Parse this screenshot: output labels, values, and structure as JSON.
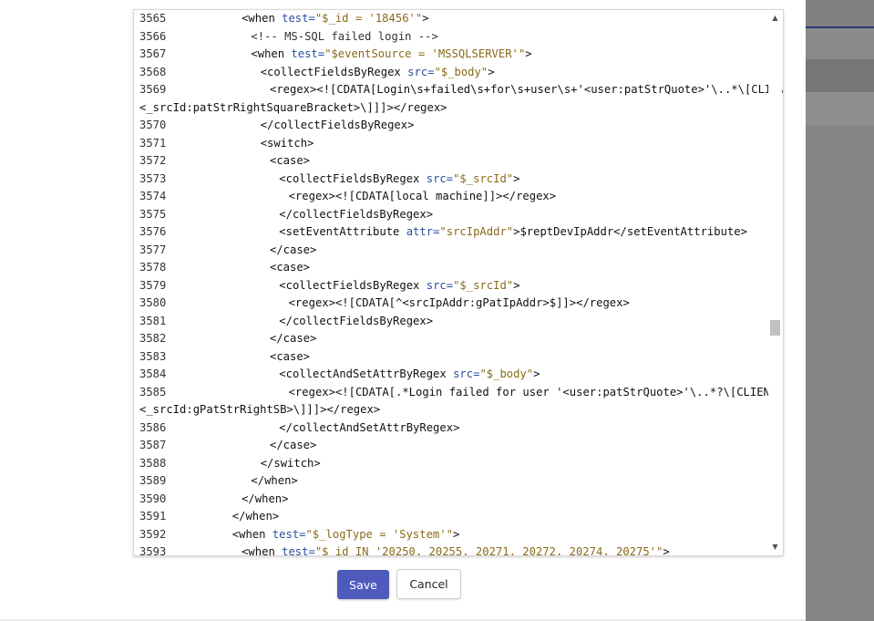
{
  "editor": {
    "lines": [
      {
        "ln": "3565",
        "indent": 7,
        "parts": [
          [
            "tag",
            "<when "
          ],
          [
            "attr",
            "test="
          ],
          [
            "val",
            "\"$_id = '18456'\""
          ],
          [
            "tag",
            ">"
          ]
        ]
      },
      {
        "ln": "3566",
        "indent": 8,
        "parts": [
          [
            "cmt",
            "<!-- MS-SQL failed login -->"
          ]
        ]
      },
      {
        "ln": "3567",
        "indent": 8,
        "parts": [
          [
            "tag",
            "<when "
          ],
          [
            "attr",
            "test="
          ],
          [
            "val",
            "\"$eventSource = 'MSSQLSERVER'\""
          ],
          [
            "tag",
            ">"
          ]
        ]
      },
      {
        "ln": "3568",
        "indent": 9,
        "parts": [
          [
            "tag",
            "<collectFieldsByRegex "
          ],
          [
            "attr",
            "src="
          ],
          [
            "val",
            "\"$_body\""
          ],
          [
            "tag",
            ">"
          ]
        ]
      },
      {
        "ln": "3569",
        "indent": 10,
        "parts": [
          [
            "tag",
            "<regex><![CDATA[Login\\s+failed\\s+for\\s+user\\s+'<user:patStrQuote>'\\..*\\[CLIENT:\\s*"
          ]
        ]
      },
      {
        "ln": "",
        "indent": 0,
        "parts": [
          [
            "tag",
            "<_srcId:patStrRightSquareBracket>\\]]]></regex>"
          ]
        ]
      },
      {
        "ln": "3570",
        "indent": 9,
        "parts": [
          [
            "tag",
            "</collectFieldsByRegex>"
          ]
        ]
      },
      {
        "ln": "3571",
        "indent": 9,
        "parts": [
          [
            "tag",
            "<switch>"
          ]
        ]
      },
      {
        "ln": "3572",
        "indent": 10,
        "parts": [
          [
            "tag",
            "<case>"
          ]
        ]
      },
      {
        "ln": "3573",
        "indent": 11,
        "parts": [
          [
            "tag",
            "<collectFieldsByRegex "
          ],
          [
            "attr",
            "src="
          ],
          [
            "val",
            "\"$_srcId\""
          ],
          [
            "tag",
            ">"
          ]
        ]
      },
      {
        "ln": "3574",
        "indent": 12,
        "parts": [
          [
            "tag",
            "<regex><![CDATA[local machine]]></regex>"
          ]
        ]
      },
      {
        "ln": "3575",
        "indent": 11,
        "parts": [
          [
            "tag",
            "</collectFieldsByRegex>"
          ]
        ]
      },
      {
        "ln": "3576",
        "indent": 11,
        "parts": [
          [
            "tag",
            "<setEventAttribute "
          ],
          [
            "attr",
            "attr="
          ],
          [
            "val",
            "\"srcIpAddr\""
          ],
          [
            "tag",
            ">$reptDevIpAddr</setEventAttribute>"
          ]
        ]
      },
      {
        "ln": "3577",
        "indent": 10,
        "parts": [
          [
            "tag",
            "</case>"
          ]
        ]
      },
      {
        "ln": "3578",
        "indent": 10,
        "parts": [
          [
            "tag",
            "<case>"
          ]
        ]
      },
      {
        "ln": "3579",
        "indent": 11,
        "parts": [
          [
            "tag",
            "<collectFieldsByRegex "
          ],
          [
            "attr",
            "src="
          ],
          [
            "val",
            "\"$_srcId\""
          ],
          [
            "tag",
            ">"
          ]
        ]
      },
      {
        "ln": "3580",
        "indent": 12,
        "parts": [
          [
            "tag",
            "<regex><![CDATA[^<srcIpAddr:gPatIpAddr>$]]></regex>"
          ]
        ]
      },
      {
        "ln": "3581",
        "indent": 11,
        "parts": [
          [
            "tag",
            "</collectFieldsByRegex>"
          ]
        ]
      },
      {
        "ln": "3582",
        "indent": 10,
        "parts": [
          [
            "tag",
            "</case>"
          ]
        ]
      },
      {
        "ln": "3583",
        "indent": 10,
        "parts": [
          [
            "tag",
            "<case>"
          ]
        ]
      },
      {
        "ln": "3584",
        "indent": 11,
        "parts": [
          [
            "tag",
            "<collectAndSetAttrByRegex "
          ],
          [
            "attr",
            "src="
          ],
          [
            "val",
            "\"$_body\""
          ],
          [
            "tag",
            ">"
          ]
        ]
      },
      {
        "ln": "3585",
        "indent": 12,
        "parts": [
          [
            "tag",
            "<regex><![CDATA[.*Login failed for user '<user:patStrQuote>'\\..*?\\[CLIENT:"
          ]
        ]
      },
      {
        "ln": "",
        "indent": 0,
        "parts": [
          [
            "tag",
            "<_srcId:gPatStrRightSB>\\]]]></regex>"
          ]
        ]
      },
      {
        "ln": "3586",
        "indent": 11,
        "parts": [
          [
            "tag",
            "</collectAndSetAttrByRegex>"
          ]
        ]
      },
      {
        "ln": "3587",
        "indent": 10,
        "parts": [
          [
            "tag",
            "</case>"
          ]
        ]
      },
      {
        "ln": "3588",
        "indent": 9,
        "parts": [
          [
            "tag",
            "</switch>"
          ]
        ]
      },
      {
        "ln": "3589",
        "indent": 8,
        "parts": [
          [
            "tag",
            "</when>"
          ]
        ]
      },
      {
        "ln": "3590",
        "indent": 7,
        "parts": [
          [
            "tag",
            "</when>"
          ]
        ]
      },
      {
        "ln": "3591",
        "indent": 6,
        "parts": [
          [
            "tag",
            "</when>"
          ]
        ]
      },
      {
        "ln": "3592",
        "indent": 6,
        "parts": [
          [
            "tag",
            "<when "
          ],
          [
            "attr",
            "test="
          ],
          [
            "val",
            "\"$_logType = 'System'\""
          ],
          [
            "tag",
            ">"
          ]
        ]
      },
      {
        "ln": "3593",
        "indent": 7,
        "parts": [
          [
            "tag",
            "<when "
          ],
          [
            "attr",
            "test="
          ],
          [
            "val",
            "\"$_id IN '20250, 20255, 20271, 20272, 20274, 20275'\""
          ],
          [
            "tag",
            ">"
          ]
        ]
      }
    ]
  },
  "scrollbar": {
    "up_icon": "▲",
    "down_icon": "▼",
    "position": 0.59
  },
  "buttons": {
    "save_label": "Save",
    "cancel_label": "Cancel"
  },
  "colors": {
    "save_bg": "#4e5bbd",
    "attr": "#2b4fa0",
    "value": "#8a6a1a"
  }
}
